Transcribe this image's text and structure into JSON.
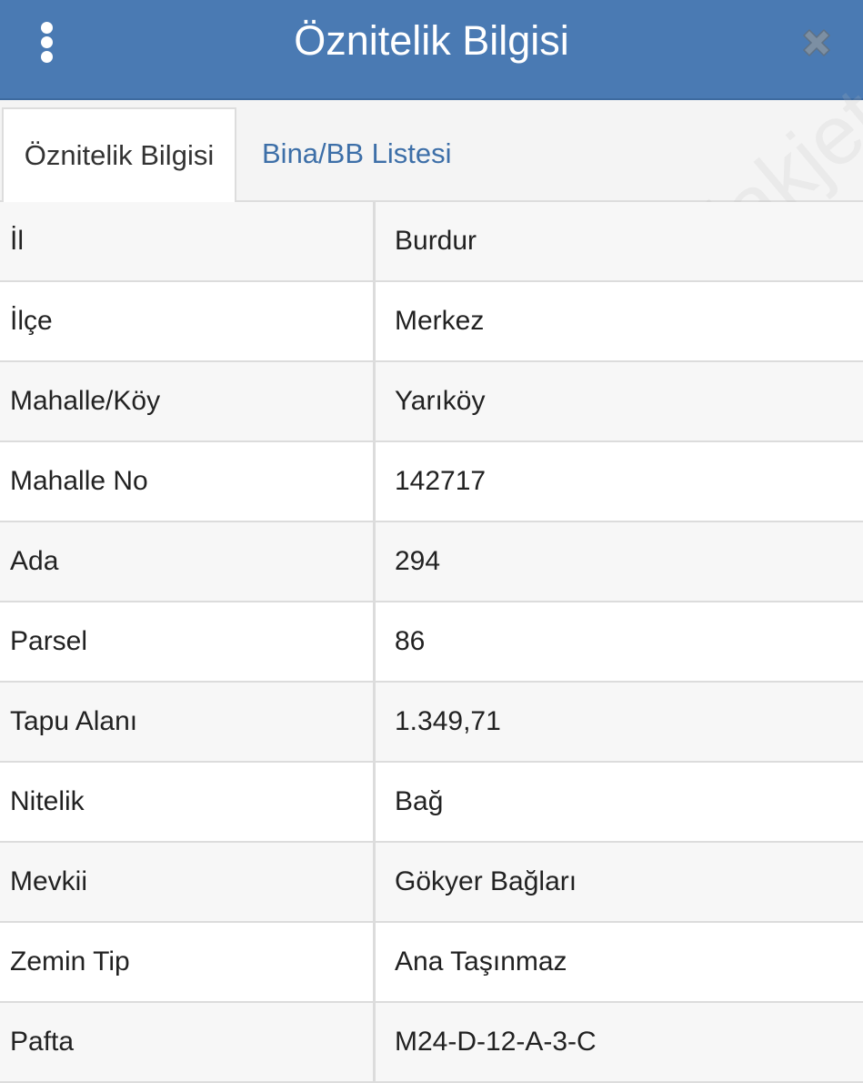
{
  "header": {
    "title": "Öznitelik Bilgisi",
    "menu_icon": "vertical-dots-icon",
    "close_icon": "close-icon",
    "background_color": "#4a7ab3"
  },
  "tabs": [
    {
      "label": "Öznitelik Bilgisi",
      "active": true
    },
    {
      "label": "Bina/BB Listesi",
      "active": false
    }
  ],
  "rows": [
    {
      "key": "İl",
      "value": "Burdur"
    },
    {
      "key": "İlçe",
      "value": "Merkez"
    },
    {
      "key": "Mahalle/Köy",
      "value": "Yarıköy"
    },
    {
      "key": "Mahalle No",
      "value": "142717"
    },
    {
      "key": "Ada",
      "value": "294"
    },
    {
      "key": "Parsel",
      "value": "86"
    },
    {
      "key": "Tapu Alanı",
      "value": "1.349,71"
    },
    {
      "key": "Nitelik",
      "value": "Bağ"
    },
    {
      "key": "Mevkii",
      "value": "Gökyer Bağları"
    },
    {
      "key": "Zemin Tip",
      "value": "Ana Taşınmaz"
    },
    {
      "key": "Pafta",
      "value": "M24-D-12-A-3-C"
    }
  ],
  "watermark": "sahibinden emlakjet.com"
}
